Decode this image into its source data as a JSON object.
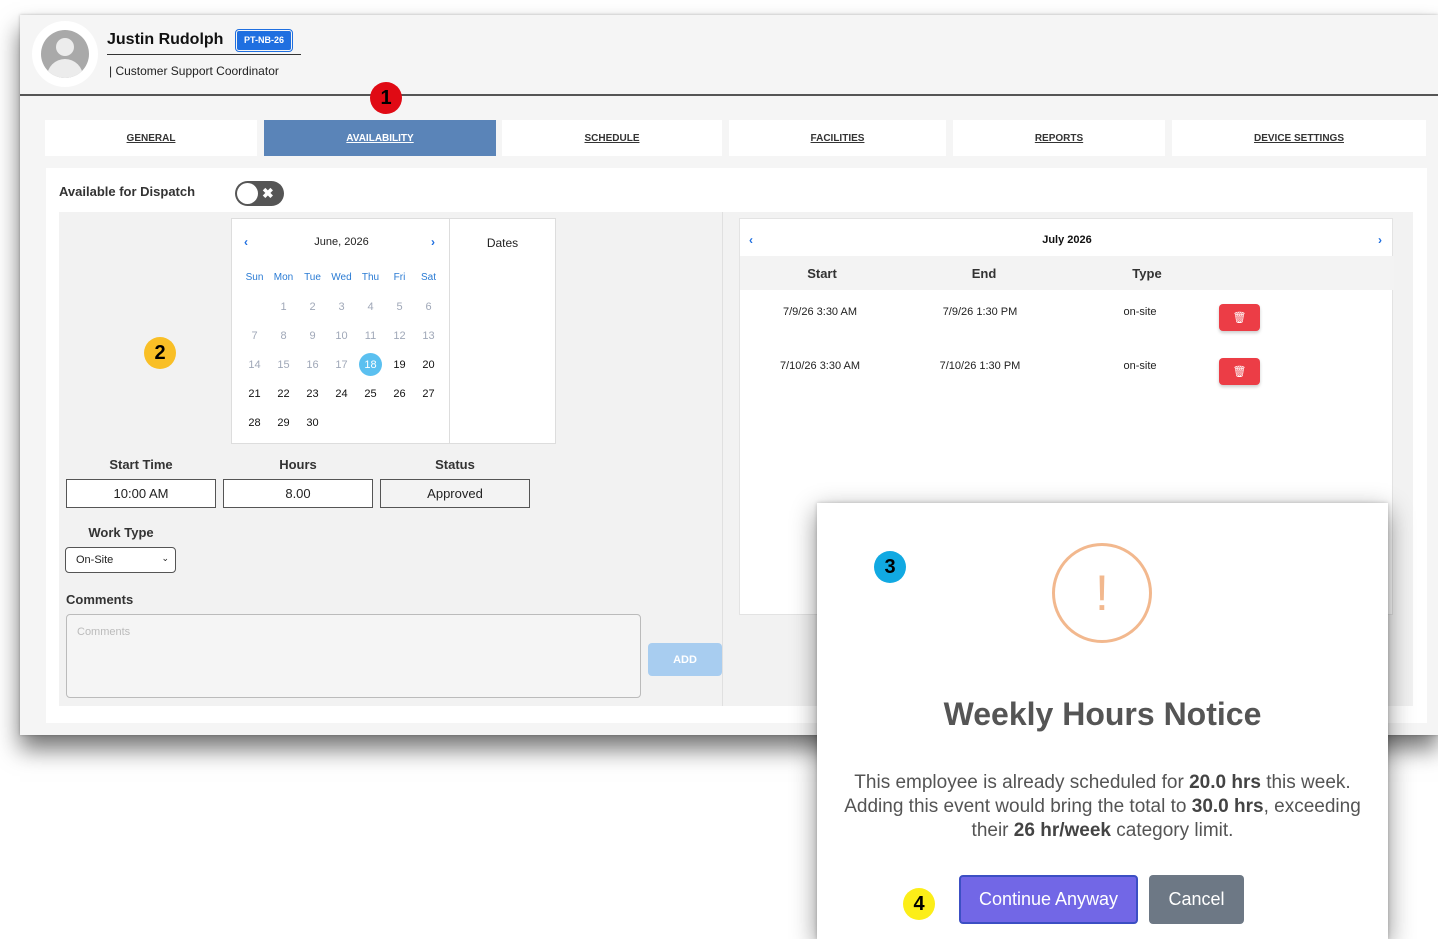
{
  "employee": {
    "name": "Justin Rudolph",
    "badge": "PT-NB-26",
    "role": "| Customer Support Coordinator"
  },
  "tabs": [
    {
      "label": "GENERAL",
      "active": false
    },
    {
      "label": "AVAILABILITY",
      "active": true
    },
    {
      "label": "SCHEDULE",
      "active": false
    },
    {
      "label": "FACILITIES",
      "active": false
    },
    {
      "label": "REPORTS",
      "active": false
    },
    {
      "label": "DEVICE SETTINGS",
      "active": false
    }
  ],
  "dispatch": {
    "label": "Available for Dispatch",
    "enabled": false
  },
  "calendar": {
    "prev": "‹",
    "next": "›",
    "month": "June, 2026",
    "weekdays": [
      "Sun",
      "Mon",
      "Tue",
      "Wed",
      "Thu",
      "Fri",
      "Sat"
    ],
    "leading_blanks": 1,
    "days": [
      1,
      2,
      3,
      4,
      5,
      6,
      7,
      8,
      9,
      10,
      11,
      12,
      13,
      14,
      15,
      16,
      17,
      18,
      19,
      20,
      21,
      22,
      23,
      24,
      25,
      26,
      27,
      28,
      29,
      30
    ],
    "today": 18,
    "dates_header": "Dates"
  },
  "form": {
    "start_time_label": "Start Time",
    "start_time_value": "10:00 AM",
    "hours_label": "Hours",
    "hours_value": "8.00",
    "status_label": "Status",
    "status_value": "Approved",
    "work_type_label": "Work Type",
    "work_type_value": "On-Site",
    "comments_label": "Comments",
    "comments_placeholder": "Comments",
    "add_label": "ADD"
  },
  "events": {
    "prev": "‹",
    "next": "›",
    "month": "July 2026",
    "columns": [
      "Start",
      "End",
      "Type"
    ],
    "rows": [
      {
        "start": "7/9/26 3:30 AM",
        "end": "7/9/26 1:30 PM",
        "type": "on-site"
      },
      {
        "start": "7/10/26 3:30 AM",
        "end": "7/10/26 1:30 PM",
        "type": "on-site"
      }
    ]
  },
  "markers": [
    "1",
    "2",
    "3",
    "4"
  ],
  "modal": {
    "icon": "!",
    "title": "Weekly Hours Notice",
    "text_1": "This employee is already scheduled for ",
    "hours_current": "20.0 hrs",
    "text_2": " this week. Adding this event would bring the total to ",
    "hours_total": "30.0 hrs",
    "text_3": ", exceeding their ",
    "limit": "26 hr/week",
    "text_4": " category limit.",
    "continue_label": "Continue Anyway",
    "cancel_label": "Cancel"
  },
  "colors": {
    "active_tab": "#5a84b8",
    "badge": "#1f6fe0",
    "today": "#5bc0f0",
    "delete": "#ec3d46",
    "continue": "#7267e6",
    "cancel": "#6d7885",
    "warning": "#f2b88e"
  }
}
